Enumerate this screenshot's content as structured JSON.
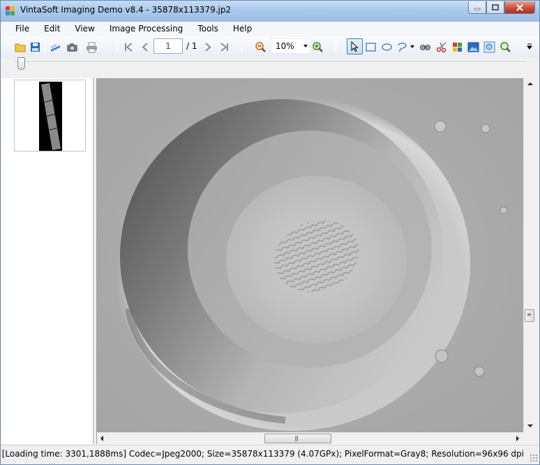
{
  "window": {
    "title": "VintaSoft Imaging Demo v8.4 - 35878x113379.jp2"
  },
  "menu": {
    "items": [
      "File",
      "Edit",
      "View",
      "Image Processing",
      "Tools",
      "Help"
    ]
  },
  "toolbar": {
    "current_page": "1",
    "total_pages": "/ 1",
    "zoom": "10%",
    "icons": [
      "open-icon",
      "save-icon",
      "scan-icon",
      "camera-icon",
      "print-icon",
      "first-page-icon",
      "prev-page-icon",
      "next-page-icon",
      "last-page-icon",
      "zoom-out-icon",
      "zoom-in-icon",
      "pointer-tool-icon",
      "rectangle-select-icon",
      "ellipse-select-icon",
      "lasso-select-icon",
      "pan-tool-icon",
      "crop-icon",
      "color-picker-icon",
      "image-tool-icon",
      "magnifier-tool-icon",
      "zoom-tool-icon"
    ]
  },
  "statusbar": {
    "text": "[Loading time: 3301,1888ms]  Codec=Jpeg2000; Size=35878x113379 (4.07GPx); PixelFormat=Gray8; Resolution=96x96 dpi"
  },
  "colors": {
    "titlebar": "#a9c8ea",
    "close_button": "#c8503a",
    "selected_tool": "#c3e0f5"
  }
}
